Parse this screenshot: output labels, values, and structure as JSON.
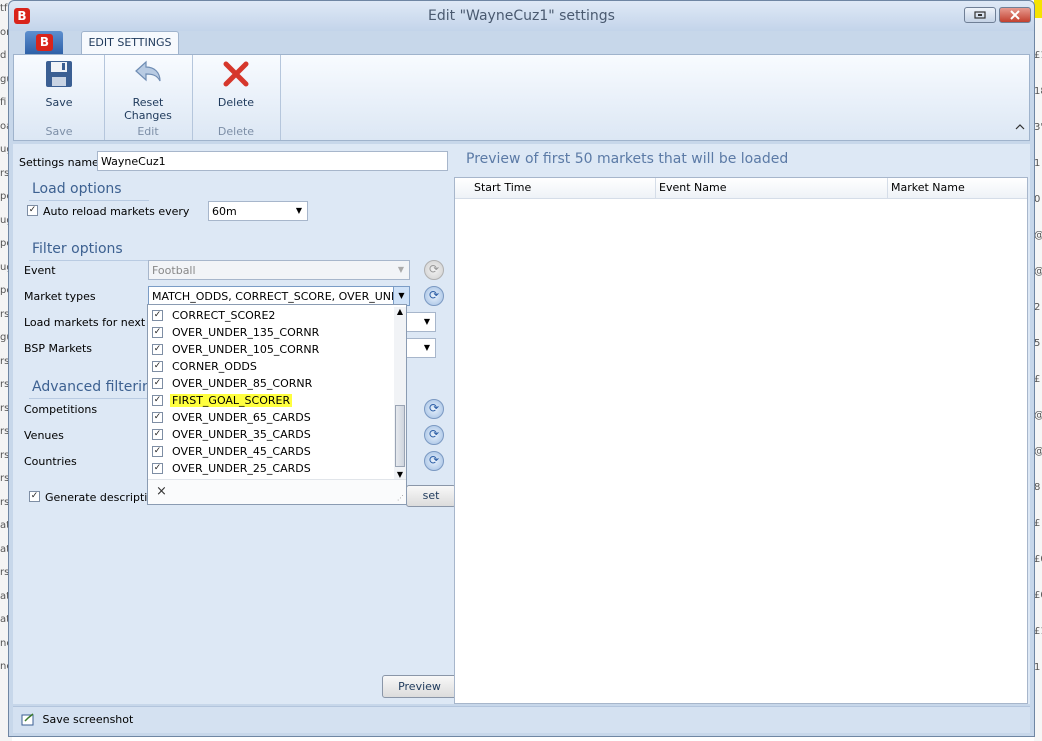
{
  "window": {
    "title": "Edit \"WayneCuz1\" settings",
    "app_icon_letter": "B",
    "restore_icon": "restore-icon",
    "close_icon": "close-icon"
  },
  "ribbon": {
    "tab_label": "EDIT SETTINGS",
    "groups": [
      {
        "button_label": "Save",
        "group_label": "Save",
        "icon": "floppy-disk-icon"
      },
      {
        "button_label_line1": "Reset",
        "button_label_line2": "Changes",
        "group_label": "Edit",
        "icon": "undo-arrow-icon"
      },
      {
        "button_label": "Delete",
        "group_label": "Delete",
        "icon": "red-x-icon"
      }
    ]
  },
  "settings": {
    "name_label": "Settings name",
    "name_value": "WayneCuz1"
  },
  "load_options": {
    "heading": "Load options",
    "auto_reload_label": "Auto reload markets every",
    "auto_reload_checked": true,
    "auto_reload_value": "60m"
  },
  "filter_options": {
    "heading": "Filter options",
    "event_label": "Event",
    "event_value": "Football",
    "market_types_label": "Market types",
    "market_types_value": "MATCH_ODDS, CORRECT_SCORE, OVER_UND...",
    "load_markets_label": "Load markets for next",
    "bsp_label": "BSP Markets"
  },
  "advanced": {
    "heading": "Advanced filtering",
    "competitions_label": "Competitions",
    "venues_label": "Venues",
    "countries_label": "Countries",
    "generate_desc_label": "Generate description fo",
    "reset_label": "set"
  },
  "dropdown": {
    "items": [
      {
        "label": "CORRECT_SCORE2",
        "checked": true,
        "highlight": false
      },
      {
        "label": "OVER_UNDER_135_CORNR",
        "checked": true,
        "highlight": false
      },
      {
        "label": "OVER_UNDER_105_CORNR",
        "checked": true,
        "highlight": false
      },
      {
        "label": "CORNER_ODDS",
        "checked": true,
        "highlight": false
      },
      {
        "label": "OVER_UNDER_85_CORNR",
        "checked": true,
        "highlight": false
      },
      {
        "label": "FIRST_GOAL_SCORER",
        "checked": true,
        "highlight": true
      },
      {
        "label": "OVER_UNDER_65_CARDS",
        "checked": true,
        "highlight": false
      },
      {
        "label": "OVER_UNDER_35_CARDS",
        "checked": true,
        "highlight": false
      },
      {
        "label": "OVER_UNDER_45_CARDS",
        "checked": true,
        "highlight": false
      },
      {
        "label": "OVER_UNDER_25_CARDS",
        "checked": true,
        "highlight": false
      }
    ],
    "clear_symbol": "×"
  },
  "preview": {
    "title": "Preview of first 50 markets that will be loaded",
    "columns": [
      "Start Time",
      "Event Name",
      "Market Name"
    ],
    "button_label": "Preview"
  },
  "status": {
    "save_screenshot_label": "Save screenshot"
  },
  "background": {
    "left_chars": [
      "tf",
      "or",
      "d",
      "gu",
      "fi",
      "oa",
      "ug",
      "rs",
      "pe",
      "ug",
      "pe",
      "ug",
      "pe",
      "rs",
      "gu",
      "rs",
      "rs",
      "rs",
      "rs",
      "rs",
      "rs",
      "rs",
      "at",
      "at",
      "rs",
      "at",
      "at",
      "ne",
      "ne"
    ],
    "right_chars": [
      "£1",
      "18",
      "3'",
      "1",
      "0",
      "@",
      "@",
      "2",
      "5",
      "£",
      "@",
      "@",
      "8",
      "£",
      "£0",
      "£0",
      "£1",
      "1"
    ]
  }
}
